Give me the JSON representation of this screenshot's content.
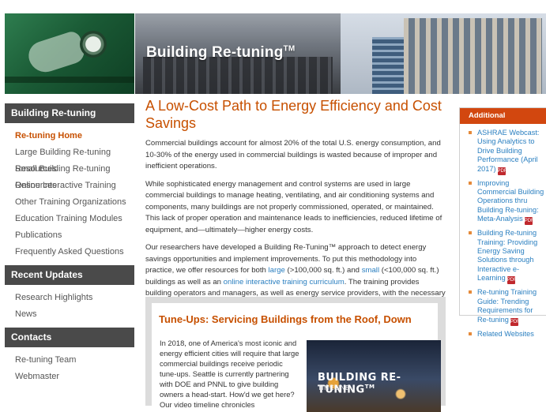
{
  "banner": {
    "title": "Building Re-tuning",
    "tm": "TM"
  },
  "sidebar": {
    "sections": [
      {
        "heading": "Building Re-tuning",
        "items": [
          "Re-tuning Home",
          "Large Building Re-tuning Resources",
          "Small Building Re-tuning Resources",
          "Online Interactive Training",
          "Other Training Organizations",
          "Education Training Modules",
          "Publications",
          "Frequently Asked Questions"
        ]
      },
      {
        "heading": "Recent Updates",
        "items": [
          "Research Highlights",
          "News"
        ]
      },
      {
        "heading": "Contacts",
        "items": [
          "Re-tuning Team",
          "Webmaster"
        ]
      }
    ]
  },
  "main": {
    "title": "A Low-Cost Path to Energy Efficiency and Cost Savings",
    "p1": "Commercial buildings account for almost 20% of the total U.S. energy consumption, and 10-30% of the energy used in commercial buildings is wasted because of improper and inefficient operations.",
    "p2": "While sophisticated energy management and control systems are used in large commercial buildings to manage heating, ventilating, and air conditioning systems and components, many buildings are not properly commissioned, operated, or maintained. This lack of proper operation and maintenance leads to inefficiencies, reduced lifetime of equipment, and—ultimately—higher energy costs.",
    "p3": {
      "t1": "Our researchers have developed a Building Re-Tuning™ approach to detect energy savings opportunities and implement improvements. To put this methodology into practice, we offer resources for both ",
      "link_large": "large",
      "t2": " (>100,000 sq. ft.) and ",
      "link_small": "small",
      "t3": " (<100,000 sq. ft.) buildings as well as an ",
      "link_training": "online interactive training curriculum",
      "t4": ". The training provides building operators and managers, as well as energy service providers, with the necessary skills to identify and correct no- and low-cost operational problems that plague commercial buildings."
    }
  },
  "feature": {
    "title": "Tune-Ups: Servicing Buildings from the Roof, Down",
    "text": "In 2018, one of America's most iconic and energy efficient cities will require that large commercial buildings receive periodic tune-ups. Seattle is currently partnering with DOE and PNNL to give building owners a head-start. How'd we get here? Our video timeline chronicles",
    "thumb_title": "BUILDING RE-TUNING",
    "thumb_tm": "TM",
    "thumb_sub": "TIMELINE"
  },
  "aside": {
    "heading": "Additional Information",
    "items": [
      {
        "label": "ASHRAE Webcast: Using Analytics to Drive Building Performance (April 2017)",
        "pdf": true
      },
      {
        "label": "Improving Commercial Building Operations thru Building Re-tuning: Meta-Analysis",
        "pdf": true
      },
      {
        "label": "Building Re-tuning Training: Providing Energy Saving Solutions through Interactive e-Learning",
        "pdf": true
      },
      {
        "label": "Re-tuning Training Guide: Trending Requirements for Re-tuning",
        "pdf": true
      },
      {
        "label": "Related Websites",
        "pdf": false
      }
    ],
    "pdf_icon_text": "PDF"
  },
  "colors": {
    "accent": "#c75000",
    "link": "#2a7fc0",
    "aside_head": "#d2470f",
    "side_head": "#4a4a4a"
  }
}
